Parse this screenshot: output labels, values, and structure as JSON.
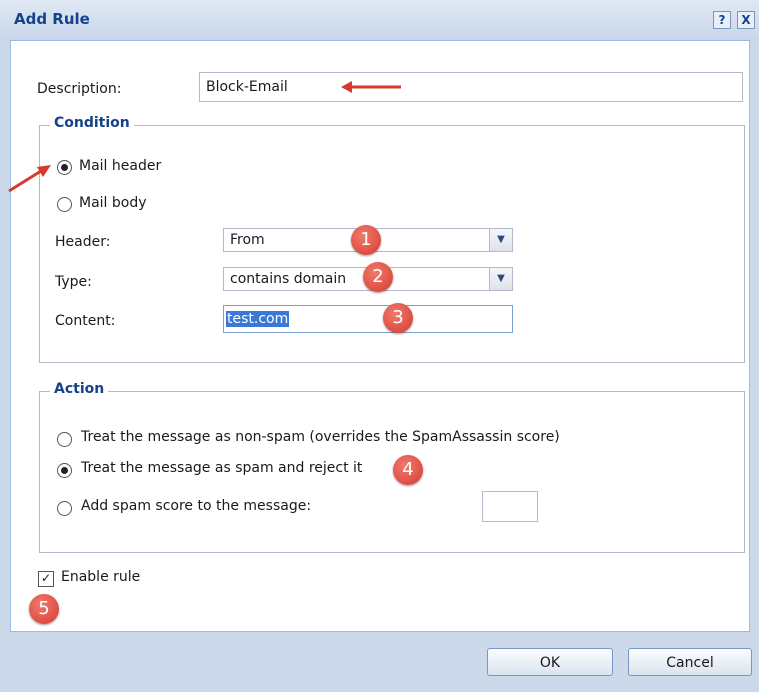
{
  "dialog": {
    "title": "Add Rule",
    "help_label": "?",
    "close_label": "X"
  },
  "description": {
    "label": "Description:",
    "value": "Block-Email"
  },
  "condition": {
    "legend": "Condition",
    "mail_header_label": "Mail header",
    "mail_body_label": "Mail body",
    "selected": "mail-header",
    "header": {
      "label": "Header:",
      "value": "From"
    },
    "type": {
      "label": "Type:",
      "value": "contains domain"
    },
    "content": {
      "label": "Content:",
      "value": "test.com"
    }
  },
  "action": {
    "legend": "Action",
    "options": [
      "Treat the message as non-spam (overrides the SpamAssassin score)",
      "Treat the message as spam and reject it",
      "Add spam score to the message:"
    ],
    "selected_index": 1,
    "spam_score_value": ""
  },
  "enable_rule": {
    "label": "Enable rule",
    "checked": true
  },
  "buttons": {
    "ok": "OK",
    "cancel": "Cancel"
  },
  "annotations": {
    "badges": [
      "1",
      "2",
      "3",
      "4",
      "5"
    ],
    "annotation_color": "#d63a2f"
  },
  "colors": {
    "title": "#15428b",
    "frame": "#ccd9ea",
    "selection": "#3a78d8"
  }
}
